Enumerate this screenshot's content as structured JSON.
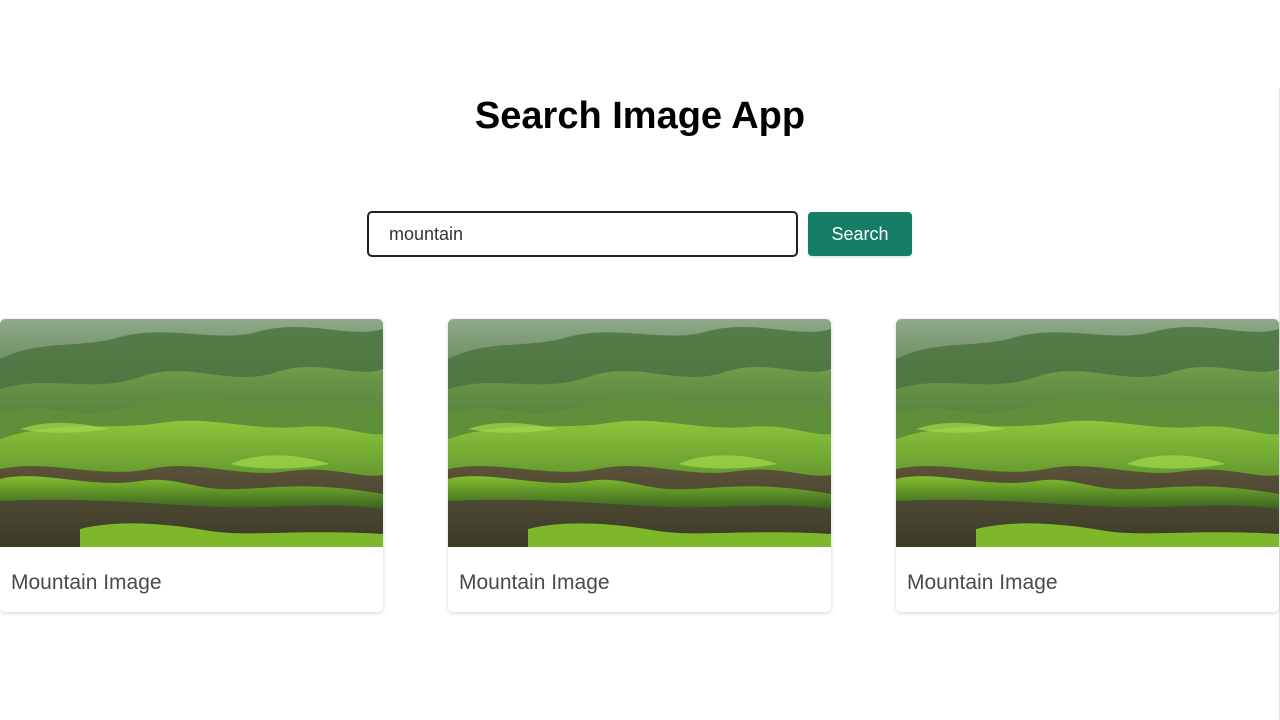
{
  "app": {
    "title": "Search Image App"
  },
  "search": {
    "value": "mountain",
    "button_label": "Search",
    "button_color": "#137e63"
  },
  "results": [
    {
      "caption": "Mountain Image"
    },
    {
      "caption": "Mountain Image"
    },
    {
      "caption": "Mountain Image"
    }
  ]
}
